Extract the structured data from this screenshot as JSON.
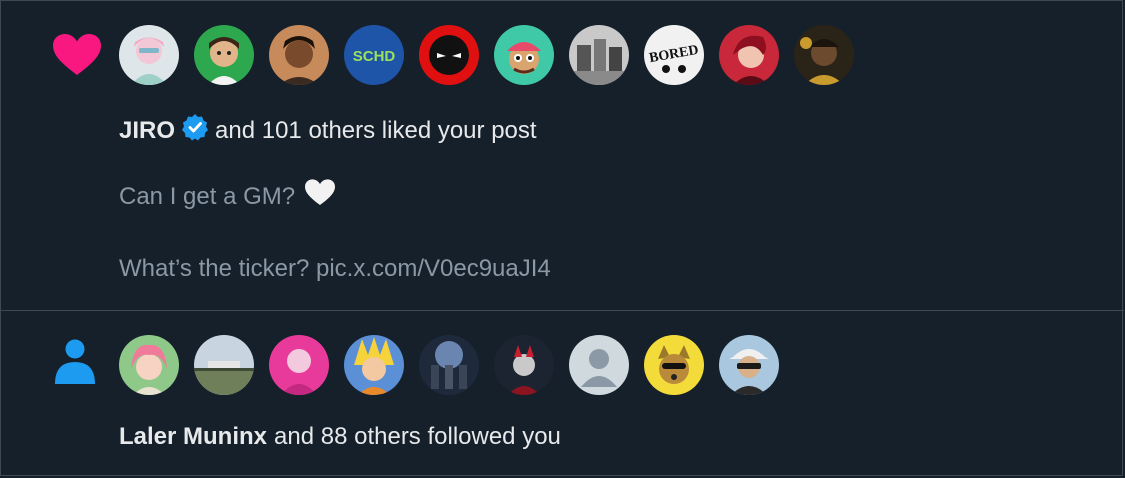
{
  "colors": {
    "background": "#15202b",
    "divider": "#3d4a56",
    "like_heart": "#f91880",
    "follow_person": "#1d9bf0",
    "verified_badge": "#1d9bf0",
    "primary_text": "#e7e9ea",
    "secondary_text": "#8b98a5"
  },
  "like_notification": {
    "type_icon": "heart-icon",
    "avatars": [
      {
        "name": "avatar-1",
        "style": "pink-hair-character"
      },
      {
        "name": "avatar-2",
        "style": "green-cartoon"
      },
      {
        "name": "avatar-3",
        "style": "dark-portrait"
      },
      {
        "name": "avatar-4",
        "label": "SCHD"
      },
      {
        "name": "avatar-5",
        "style": "red-ninja"
      },
      {
        "name": "avatar-6",
        "style": "teal-cap-character"
      },
      {
        "name": "avatar-7",
        "style": "grey-photo"
      },
      {
        "name": "avatar-8",
        "label": "BORED"
      },
      {
        "name": "avatar-9",
        "style": "red-anime"
      },
      {
        "name": "avatar-10",
        "style": "dark-gold"
      }
    ],
    "headline_name": "JIRO",
    "headline_rest": "and 101 others liked your post",
    "post_line1": "Can I get a GM?",
    "post_line2": "What’s the ticker? pic.x.com/V0ec9uaJI4"
  },
  "follow_notification": {
    "type_icon": "person-icon",
    "avatars": [
      {
        "name": "avatar-1",
        "style": "pink-hair-anime"
      },
      {
        "name": "avatar-2",
        "style": "landscape"
      },
      {
        "name": "avatar-3",
        "style": "magenta-portrait"
      },
      {
        "name": "avatar-4",
        "style": "yellow-anime"
      },
      {
        "name": "avatar-5",
        "style": "blue-dark-scene"
      },
      {
        "name": "avatar-6",
        "style": "dark-red-character"
      },
      {
        "name": "avatar-7",
        "style": "default-silhouette"
      },
      {
        "name": "avatar-8",
        "style": "yellow-dog"
      },
      {
        "name": "avatar-9",
        "style": "cap-sunglasses"
      }
    ],
    "headline_name": "Laler Muninx",
    "headline_rest": "and 88 others followed you"
  }
}
